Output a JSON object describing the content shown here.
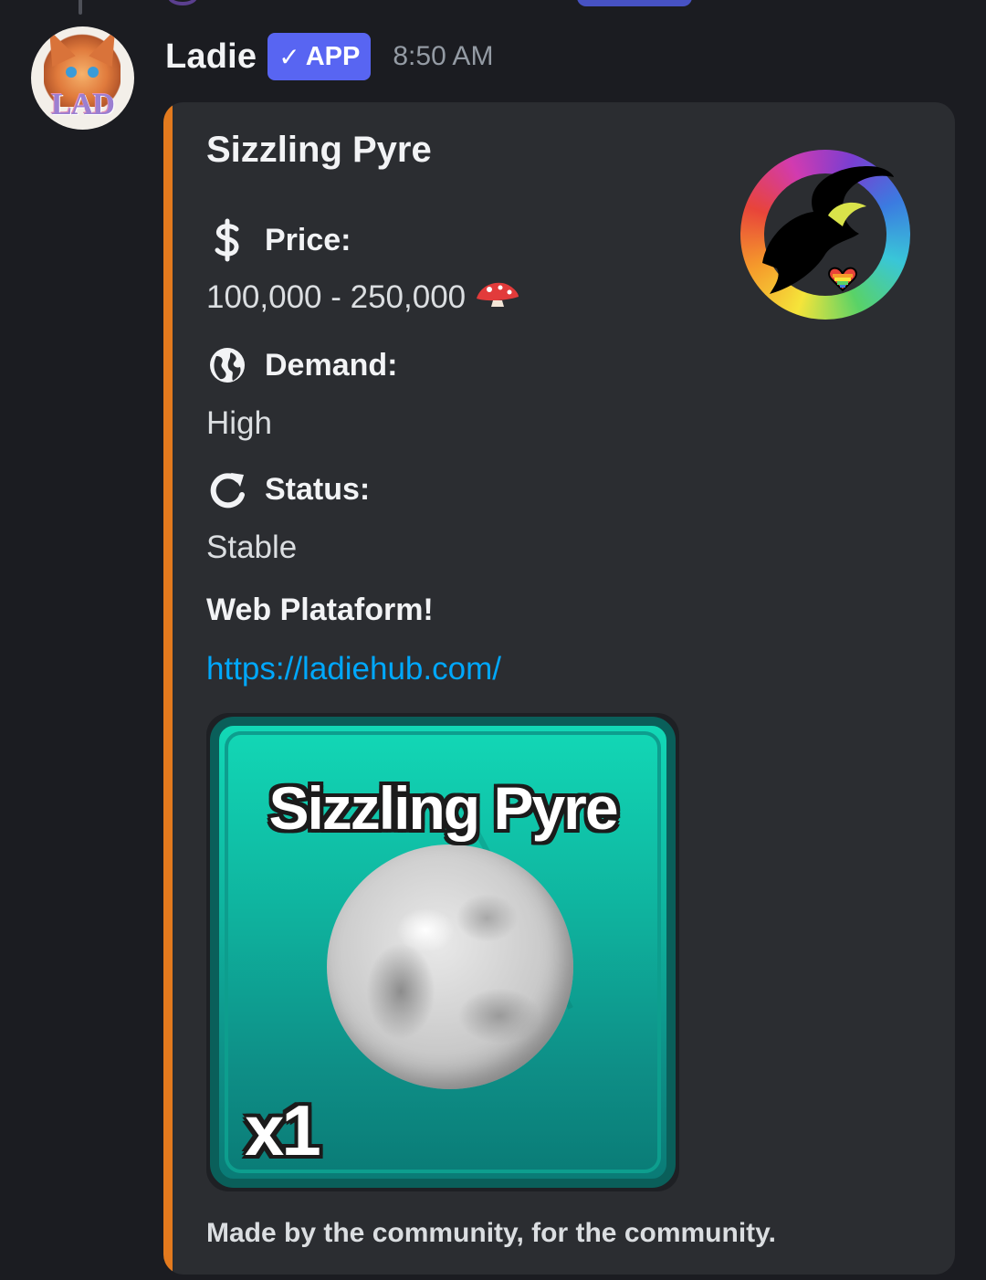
{
  "message": {
    "author": "Ladie",
    "badge": {
      "check": "✓",
      "label": "APP",
      "color": "#5865f2"
    },
    "timestamp": "8:50 AM",
    "avatar_text": "LAD"
  },
  "embed": {
    "accent_color": "#e37a1e",
    "title": "Sizzling Pyre",
    "fields": [
      {
        "icon": "dollar-icon",
        "name": "Price:",
        "value": "100,000 - 250,000",
        "value_emoji": "mushroom-icon"
      },
      {
        "icon": "globe-icon",
        "name": "Demand:",
        "value": "High"
      },
      {
        "icon": "refresh-icon",
        "name": "Status:",
        "value": "Stable"
      }
    ],
    "web": {
      "title": "Web Plataform!",
      "url": "https://ladiehub.com/"
    },
    "image": {
      "item_name": "Sizzling Pyre",
      "quantity": "x1"
    },
    "footer": "Made by the community, for the community."
  },
  "colors": {
    "link": "#00a8fc",
    "background": "#1b1c21",
    "embed_bg": "#2b2d31"
  }
}
